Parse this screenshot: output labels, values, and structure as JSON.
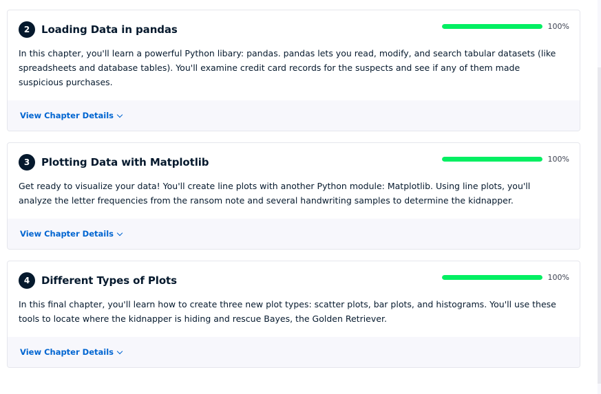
{
  "chapters": [
    {
      "number": "2",
      "title": "Loading Data in pandas",
      "progress": 1.0,
      "progress_label": "100%",
      "description": "In this chapter, you'll learn a powerful Python libary: pandas. pandas lets you read, modify, and search tabular datasets (like spreadsheets and database tables). You'll examine credit card records for the suspects and see if any of them made suspicious purchases.",
      "details_label": "View Chapter Details"
    },
    {
      "number": "3",
      "title": "Plotting Data with Matplotlib",
      "progress": 1.0,
      "progress_label": "100%",
      "description": "Get ready to visualize your data! You'll create line plots with another Python module: Matplotlib. Using line plots, you'll analyze the letter frequencies from the ransom note and several handwriting samples to determine the kidnapper.",
      "details_label": "View Chapter Details"
    },
    {
      "number": "4",
      "title": "Different Types of Plots",
      "progress": 1.0,
      "progress_label": "100%",
      "description": "In this final chapter, you'll learn how to create three new plot types: scatter plots, bar plots, and histograms. You'll use these tools to locate where the kidnapper is hiding and rescue Bayes, the Golden Retriever.",
      "details_label": "View Chapter Details"
    }
  ],
  "colors": {
    "progress_fill": "#03ef62",
    "link": "#0065d1",
    "text": "#05192d",
    "footer_bg": "#f7f7fc"
  }
}
